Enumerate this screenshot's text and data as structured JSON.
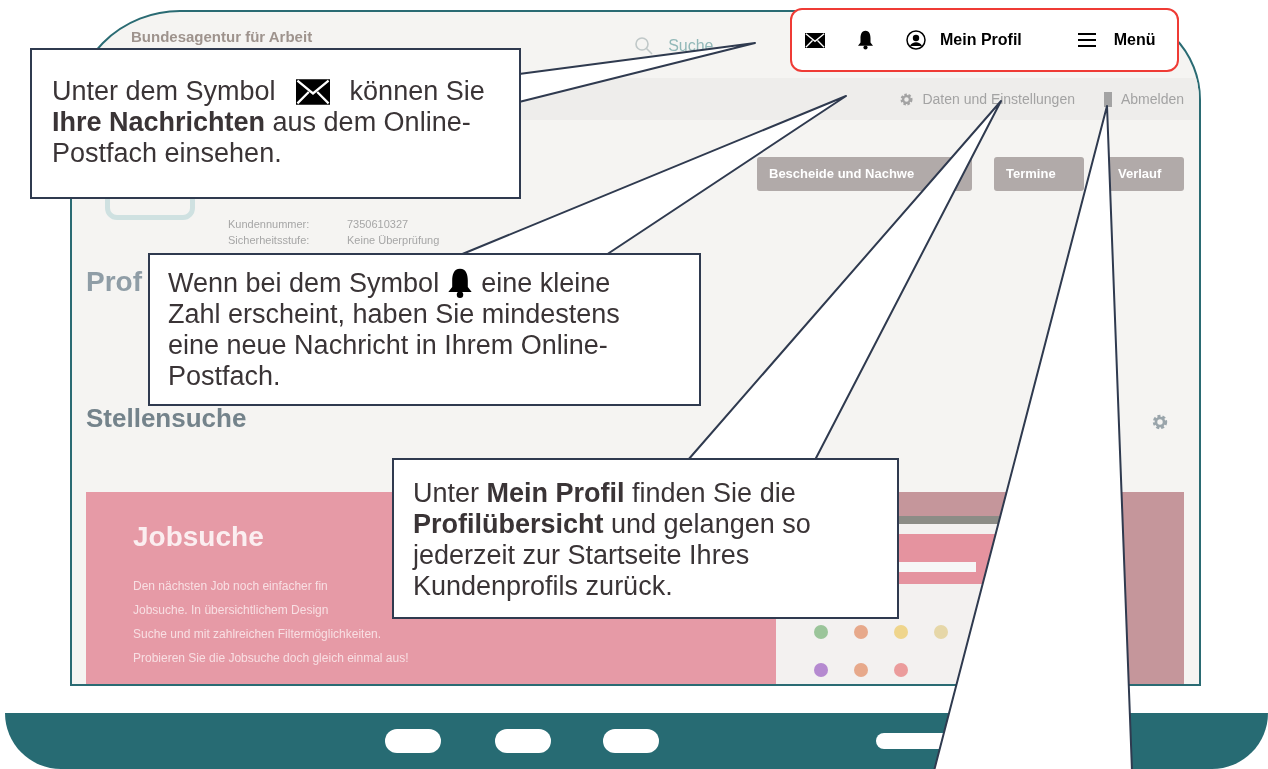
{
  "header": {
    "logo_text": "Bundesagentur für Arbeit",
    "search_label": "Suche"
  },
  "highlight_bar": {
    "profile_label": "Mein Profil",
    "menu_label": "Menü"
  },
  "subnav": [
    {
      "kind": "settings",
      "label": "Daten und Einstellungen"
    },
    {
      "kind": "logout",
      "label": "Abmelden"
    }
  ],
  "profile": {
    "fields": [
      {
        "label": "Kundennummer:",
        "value": "7350610327"
      },
      {
        "label": "Sicherheitsstufe:",
        "value": "Keine Überprüfung"
      }
    ],
    "buttons": [
      "Bescheide und Nachwe",
      "Termine",
      "Verlauf"
    ]
  },
  "page_title": "Prof",
  "section_title": "Stellensuche",
  "job_card": {
    "title": "Jobsuche",
    "lines": [
      "Den nächsten Job noch einfacher fin",
      "Jobsuche. In übersichtlichem Design",
      "Suche und mit zahlreichen Filtermöglichkeiten.",
      "Probieren Sie die Jobsuche doch gleich einmal aus!"
    ]
  },
  "callouts": [
    {
      "kind": "mail",
      "before": "Unter dem Symbol",
      "after": "können Sie",
      "lines": [
        "**Ihre Nachrichten** aus dem Online-",
        "Postfach einsehen."
      ]
    },
    {
      "kind": "bell",
      "before": "Wenn bei dem Symbol",
      "after": "eine kleine",
      "lines": [
        "Zahl erscheint, haben Sie mindestens",
        "eine neue Nachricht in Ihrem Online-",
        "Postfach."
      ]
    },
    {
      "kind": "text",
      "lines": [
        "Unter **Mein Profil** finden Sie die",
        "**Profilübersicht** und gelangen so",
        "jederzeit zur Startseite Ihres",
        "Kundenprofils zurück."
      ]
    }
  ]
}
